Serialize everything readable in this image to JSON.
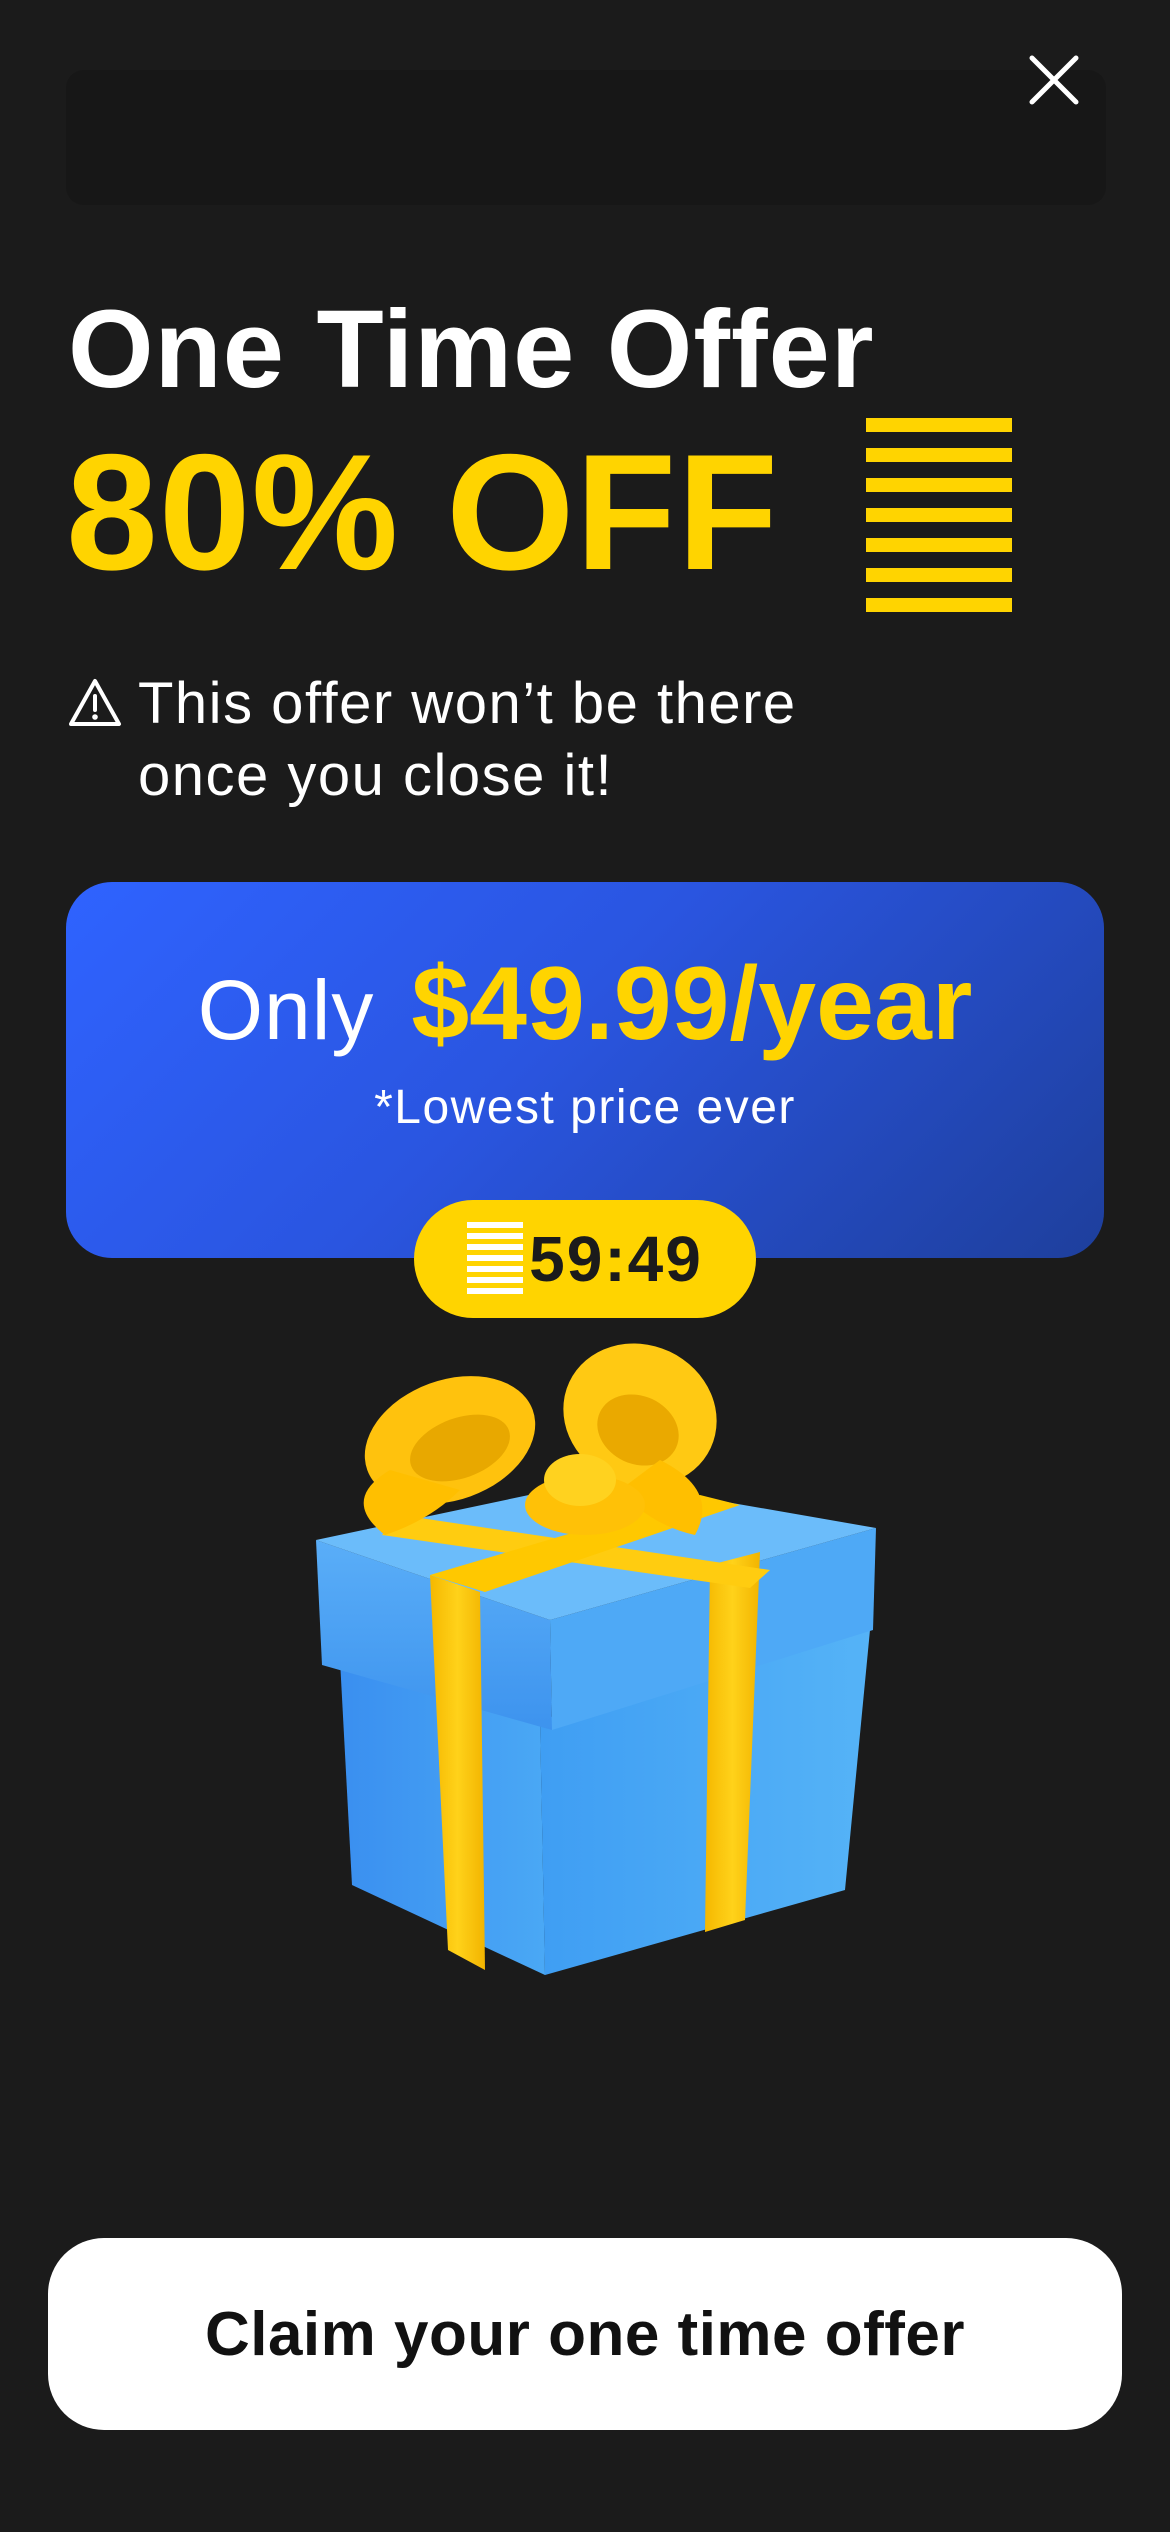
{
  "offer": {
    "title": "One Time Offer",
    "discount": "80% OFF",
    "warning": "This offer won’t be there once you close it!"
  },
  "price_card": {
    "prefix": "Only",
    "amount": "$49.99/year",
    "subtitle": "*Lowest price ever"
  },
  "timer": {
    "value": "59:49"
  },
  "cta": {
    "label": "Claim your one time offer"
  },
  "icons": {
    "close": "close-icon",
    "warning": "warning-icon",
    "stripes": "stripes-icon",
    "gift": "gift-box-image"
  },
  "colors": {
    "background": "#1b1b1b",
    "accent_yellow": "#ffd400",
    "card_blue": "#2f63ff",
    "text_white": "#ffffff",
    "cta_background": "#ffffff"
  }
}
